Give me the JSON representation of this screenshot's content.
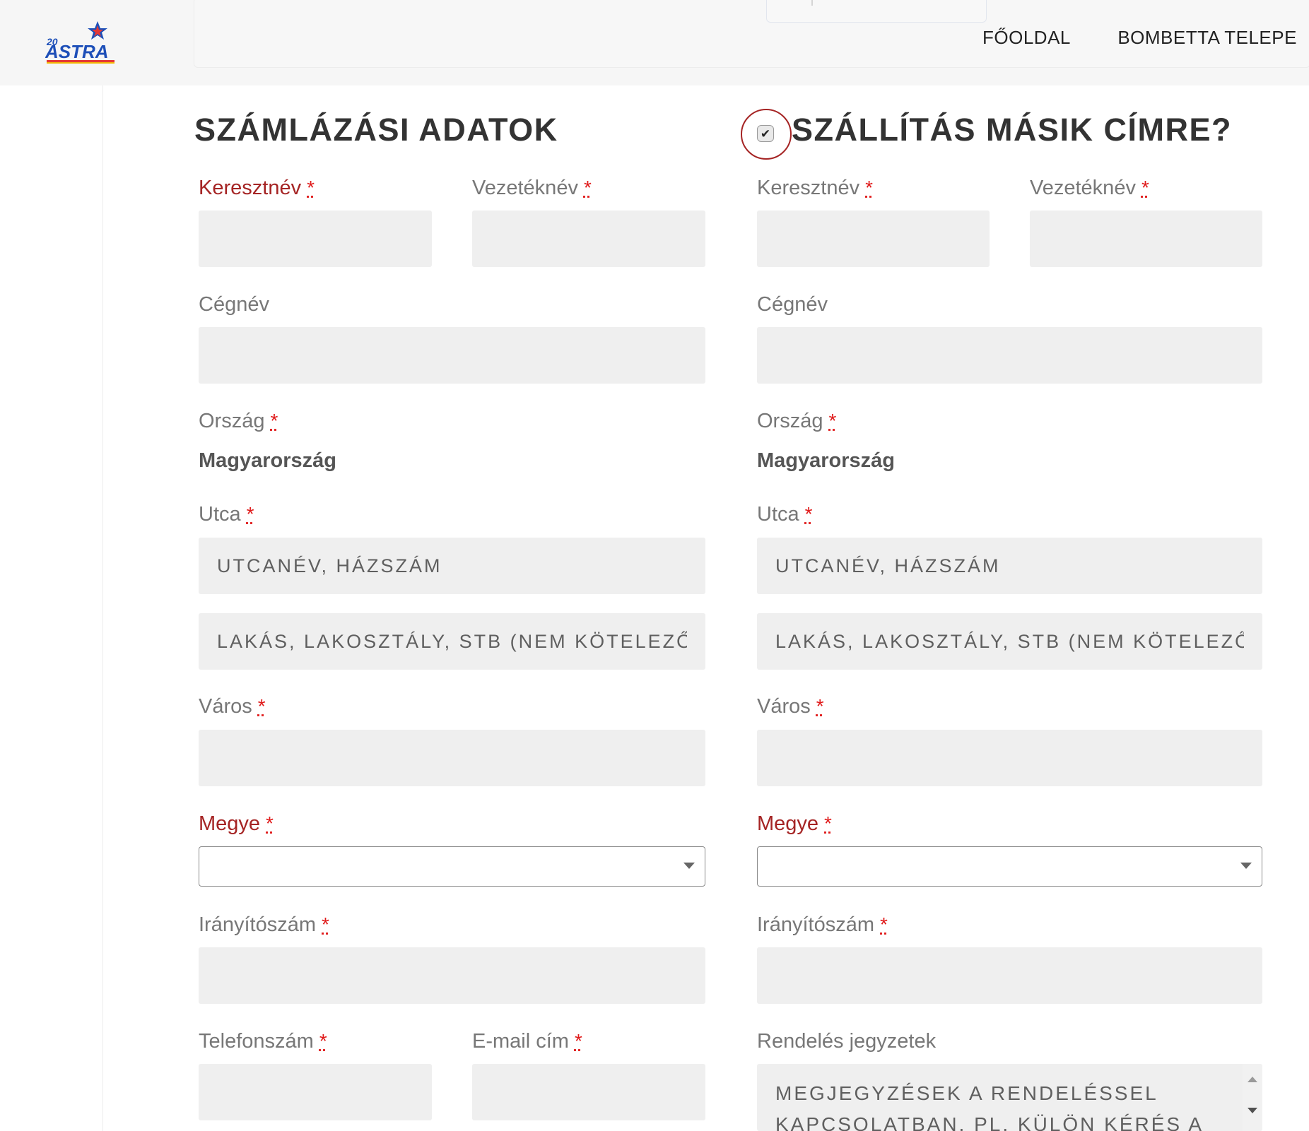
{
  "header": {
    "nav": [
      "FŐOLDAL",
      "BOMBETTA TELEPE"
    ]
  },
  "billing": {
    "title": "SZÁMLÁZÁSI ADATOK",
    "first_name_label": "Keresztnév",
    "last_name_label": "Vezetéknév",
    "company_label": "Cégnév",
    "country_label": "Ország",
    "country_value": "Magyarország",
    "street_label": "Utca",
    "street_placeholder": "Utcanév, házszám",
    "apartment_placeholder": "Lakás, lakosztály, stb (nem kötelező)",
    "city_label": "Város",
    "county_label": "Megye",
    "county_value": "",
    "zip_label": "Irányítószám",
    "phone_label": "Telefonszám",
    "email_label": "E-mail cím"
  },
  "shipping": {
    "title": "SZÁLLÍTÁS MÁSIK CÍMRE?",
    "checked": true,
    "checkmark": "✔",
    "first_name_label": "Keresztnév",
    "last_name_label": "Vezetéknév",
    "company_label": "Cégnév",
    "country_label": "Ország",
    "country_value": "Magyarország",
    "street_label": "Utca",
    "street_placeholder": "Utcanév, házszám",
    "apartment_placeholder": "Lakás, lakosztály, stb (nem kötelező)",
    "city_label": "Város",
    "county_label": "Megye",
    "county_value": "",
    "zip_label": "Irányítószám",
    "notes_label": "Rendelés jegyzetek",
    "notes_placeholder": "Megjegyzések a rendeléssel kapcsolatban, pl. külön kérés a"
  },
  "required_mark": "*",
  "colors": {
    "error_label": "#a52424",
    "required": "#e01b1b",
    "field_bg": "#efefef",
    "header_bg": "#f6f6f6"
  }
}
